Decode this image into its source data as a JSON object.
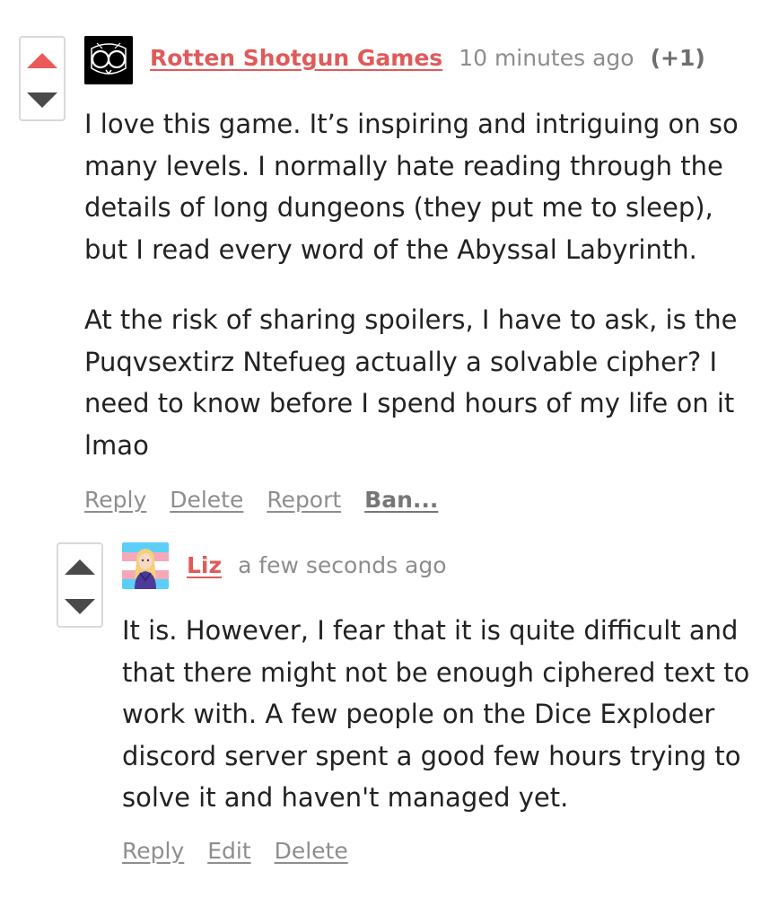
{
  "comments": [
    {
      "author": "Rotten Shotgun Games",
      "time": "10 minutes ago",
      "score": "(+1)",
      "paragraphs": [
        "I love this game. It’s inspiring and intriguing on so many levels. I normally hate reading through the details of long dungeons (they put me to sleep), but I read every word of the Abyssal Labyrinth.",
        "At the risk of sharing spoilers, I have to ask, is the Puqvsextirz Ntefueg actually a solvable cipher? I need to know before I spend hours of my life on it lmao"
      ],
      "actions": [
        "Reply",
        "Delete",
        "Report",
        "Ban..."
      ],
      "avatar_icon": "skull-avatar-icon",
      "upvoted": true
    },
    {
      "author": "Liz",
      "time": "a few seconds ago",
      "paragraphs": [
        "It is. However, I fear that it is quite difficult and that there might not be enough ciphered text to work with. A few people on the Dice Exploder discord server spent a good few hours trying to solve it and haven't managed yet."
      ],
      "actions": [
        "Reply",
        "Edit",
        "Delete"
      ],
      "avatar_icon": "trans-flag-avatar-icon",
      "upvoted": false
    }
  ],
  "colors": {
    "accent": "#e05a5a",
    "upvote_active": "#ea5a5a",
    "arrow": "#4a4a4a",
    "muted": "#8d8d8d",
    "trans_blue": "#5bcefa",
    "trans_pink": "#f5a9b8"
  }
}
